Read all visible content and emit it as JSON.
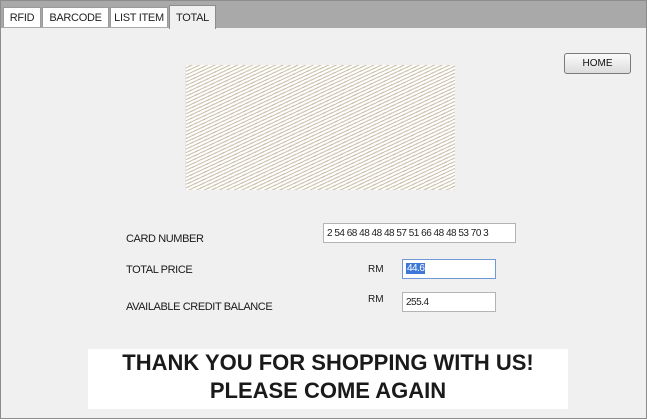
{
  "tabs": [
    {
      "label": "RFID"
    },
    {
      "label": "BARCODE"
    },
    {
      "label": "LIST ITEM"
    },
    {
      "label": "TOTAL"
    }
  ],
  "home_button": {
    "label": "HOME"
  },
  "form": {
    "card_number": {
      "label": "CARD NUMBER",
      "value": "2 54 68 48 48 48 57 51 66 48 48 53 70 3"
    },
    "total_price": {
      "label": "TOTAL PRICE",
      "currency": "RM",
      "value": "44.6"
    },
    "available_balance": {
      "label": "AVAILABLE CREDIT BALANCE",
      "currency": "RM",
      "value": "255.4"
    }
  },
  "banner": {
    "line1": "THANK YOU FOR SHOPPING WITH US!",
    "line2": "PLEASE COME AGAIN"
  }
}
